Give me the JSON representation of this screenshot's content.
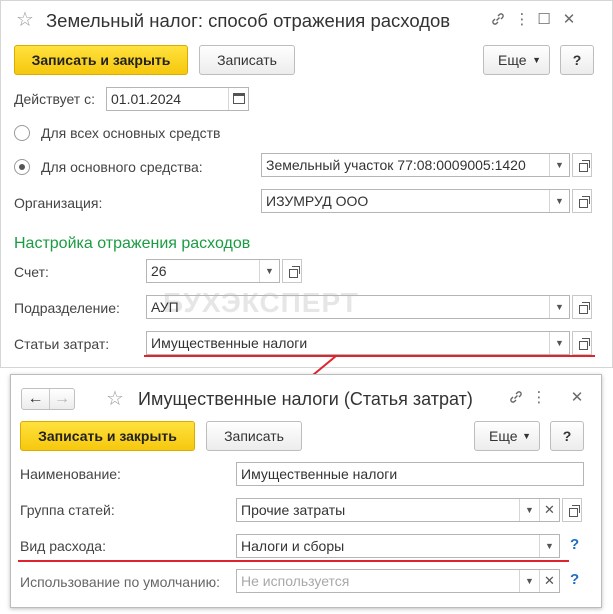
{
  "window1": {
    "title": "Земельный налог: способ отражения расходов",
    "toolbar": {
      "save_close": "Записать и закрыть",
      "save": "Записать",
      "more": "Еще",
      "help": "?"
    },
    "active_from_label": "Действует с:",
    "active_from_value": "01.01.2024",
    "radio_all": "Для всех основных средств",
    "radio_one": "Для основного средства:",
    "asset_value": "Земельный участок 77:08:0009005:1420",
    "org_label": "Организация:",
    "org_value": "ИЗУМРУД ООО",
    "section_title": "Настройка отражения расходов",
    "account_label": "Счет:",
    "account_value": "26",
    "dept_label": "Подразделение:",
    "dept_value": "АУП",
    "cost_label": "Статьи затрат:",
    "cost_value": "Имущественные налоги",
    "watermark": "БУХЭКСПЕРТ"
  },
  "window2": {
    "title": "Имущественные налоги (Статья затрат)",
    "toolbar": {
      "save_close": "Записать и закрыть",
      "save": "Записать",
      "more": "Еще",
      "help": "?"
    },
    "name_label": "Наименование:",
    "name_value": "Имущественные налоги",
    "group_label": "Группа статей:",
    "group_value": "Прочие затраты",
    "type_label": "Вид расхода:",
    "type_value": "Налоги и сборы",
    "default_label": "Использование по умолчанию:",
    "default_placeholder": "Не используется"
  },
  "icons": {
    "star": "☆",
    "link": "link-icon",
    "more": "⋮",
    "maximize": "☐",
    "close": "✕",
    "back": "←",
    "forward": "→",
    "dropdown": "▼",
    "clear": "✕"
  },
  "colors": {
    "accent_yellow": "#f6c80e",
    "section_green": "#1a9c41",
    "highlight_red": "#e0242e",
    "help_blue": "#1e6fc2"
  }
}
